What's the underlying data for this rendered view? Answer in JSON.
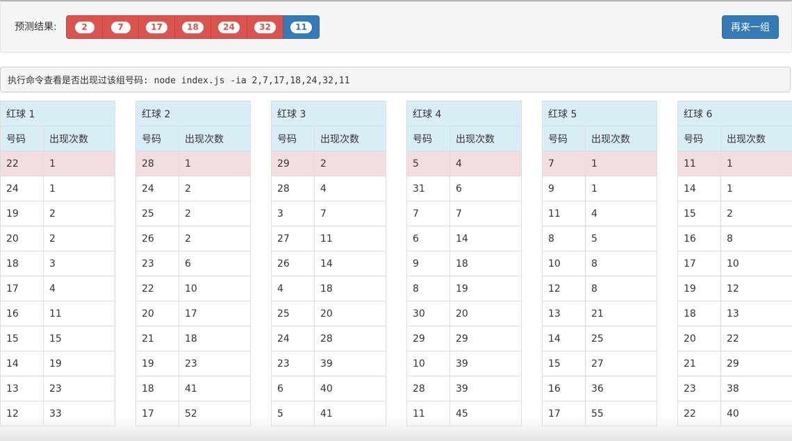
{
  "header": {
    "prediction_label": "预测结果:",
    "balls": [
      {
        "value": "2",
        "color": "red"
      },
      {
        "value": "7",
        "color": "red"
      },
      {
        "value": "17",
        "color": "red"
      },
      {
        "value": "18",
        "color": "red"
      },
      {
        "value": "24",
        "color": "red"
      },
      {
        "value": "32",
        "color": "red"
      },
      {
        "value": "11",
        "color": "blue"
      }
    ],
    "again_button": "再来一组"
  },
  "command": {
    "text": "执行命令查看是否出现过该组号码: node index.js -ia 2,7,17,18,24,32,11"
  },
  "colors": {
    "red": "#d9534f",
    "blue": "#337ab7",
    "table_header": "#d9edf7",
    "highlight_row": "#f2dede"
  },
  "tables": [
    {
      "title": "红球 1",
      "col_number": "号码",
      "col_count": "出现次数",
      "rows": [
        [
          "22",
          "1"
        ],
        [
          "24",
          "1"
        ],
        [
          "19",
          "2"
        ],
        [
          "20",
          "2"
        ],
        [
          "18",
          "3"
        ],
        [
          "17",
          "4"
        ],
        [
          "16",
          "11"
        ],
        [
          "15",
          "15"
        ],
        [
          "14",
          "19"
        ],
        [
          "13",
          "23"
        ],
        [
          "12",
          "33"
        ]
      ]
    },
    {
      "title": "红球 2",
      "col_number": "号码",
      "col_count": "出现次数",
      "rows": [
        [
          "28",
          "1"
        ],
        [
          "24",
          "2"
        ],
        [
          "25",
          "2"
        ],
        [
          "26",
          "2"
        ],
        [
          "23",
          "6"
        ],
        [
          "22",
          "10"
        ],
        [
          "20",
          "17"
        ],
        [
          "21",
          "18"
        ],
        [
          "19",
          "23"
        ],
        [
          "18",
          "41"
        ],
        [
          "17",
          "52"
        ]
      ]
    },
    {
      "title": "红球 3",
      "col_number": "号码",
      "col_count": "出现次数",
      "rows": [
        [
          "29",
          "2"
        ],
        [
          "28",
          "4"
        ],
        [
          "3",
          "7"
        ],
        [
          "27",
          "11"
        ],
        [
          "26",
          "14"
        ],
        [
          "4",
          "18"
        ],
        [
          "25",
          "20"
        ],
        [
          "24",
          "28"
        ],
        [
          "23",
          "39"
        ],
        [
          "6",
          "40"
        ],
        [
          "5",
          "41"
        ]
      ]
    },
    {
      "title": "红球 4",
      "col_number": "号码",
      "col_count": "出现次数",
      "rows": [
        [
          "5",
          "4"
        ],
        [
          "31",
          "6"
        ],
        [
          "7",
          "7"
        ],
        [
          "6",
          "14"
        ],
        [
          "9",
          "18"
        ],
        [
          "8",
          "19"
        ],
        [
          "30",
          "20"
        ],
        [
          "29",
          "29"
        ],
        [
          "10",
          "39"
        ],
        [
          "28",
          "39"
        ],
        [
          "11",
          "45"
        ]
      ]
    },
    {
      "title": "红球 5",
      "col_number": "号码",
      "col_count": "出现次数",
      "rows": [
        [
          "7",
          "1"
        ],
        [
          "9",
          "1"
        ],
        [
          "11",
          "4"
        ],
        [
          "8",
          "5"
        ],
        [
          "10",
          "8"
        ],
        [
          "12",
          "8"
        ],
        [
          "13",
          "21"
        ],
        [
          "14",
          "25"
        ],
        [
          "15",
          "27"
        ],
        [
          "16",
          "36"
        ],
        [
          "17",
          "55"
        ]
      ]
    },
    {
      "title": "红球 6",
      "col_number": "号码",
      "col_count": "出现次数",
      "rows": [
        [
          "11",
          "1"
        ],
        [
          "14",
          "1"
        ],
        [
          "15",
          "2"
        ],
        [
          "16",
          "8"
        ],
        [
          "17",
          "10"
        ],
        [
          "19",
          "12"
        ],
        [
          "18",
          "13"
        ],
        [
          "20",
          "22"
        ],
        [
          "21",
          "29"
        ],
        [
          "23",
          "38"
        ],
        [
          "22",
          "40"
        ]
      ]
    }
  ]
}
